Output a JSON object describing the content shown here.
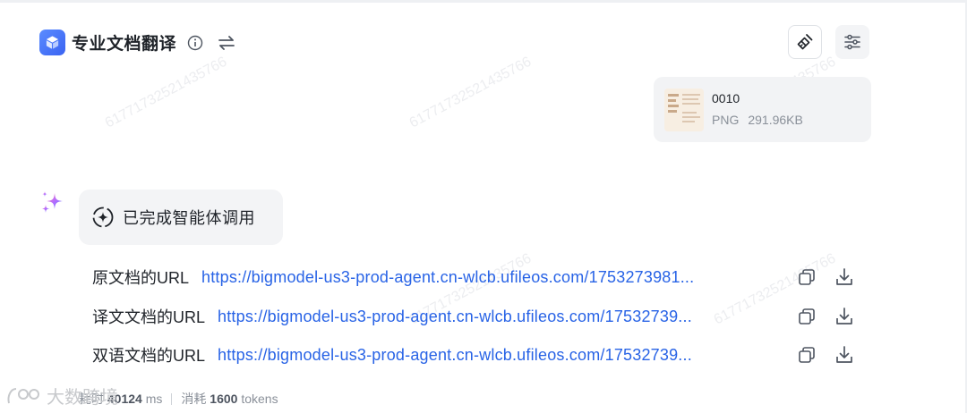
{
  "header": {
    "title": "专业文档翻译",
    "info_icon": "info-circle-icon",
    "swap_icon": "swap-arrows-icon"
  },
  "toolbar": {
    "clean_icon": "broom-icon",
    "settings_icon": "sliders-icon"
  },
  "file": {
    "name": "0010",
    "type": "PNG",
    "size": "291.96KB"
  },
  "agent": {
    "status_text": "已完成智能体调用"
  },
  "results": [
    {
      "label": "原文档的URL",
      "url": "https://bigmodel-us3-prod-agent.cn-wlcb.ufileos.com/1753273981..."
    },
    {
      "label": "译文文档的URL",
      "url": "https://bigmodel-us3-prod-agent.cn-wlcb.ufileos.com/17532739..."
    },
    {
      "label": "双语文档的URL",
      "url": "https://bigmodel-us3-prod-agent.cn-wlcb.ufileos.com/17532739..."
    }
  ],
  "footer": {
    "time_label": "耗时",
    "time_value": "40124",
    "time_unit": "ms",
    "tokens_label": "消耗",
    "tokens_value": "1600",
    "tokens_unit": "tokens"
  },
  "watermark": "61771732521435766",
  "corner_badge": "大数跨境",
  "colors": {
    "link": "#2863e6",
    "logo": "#3a63f2"
  }
}
